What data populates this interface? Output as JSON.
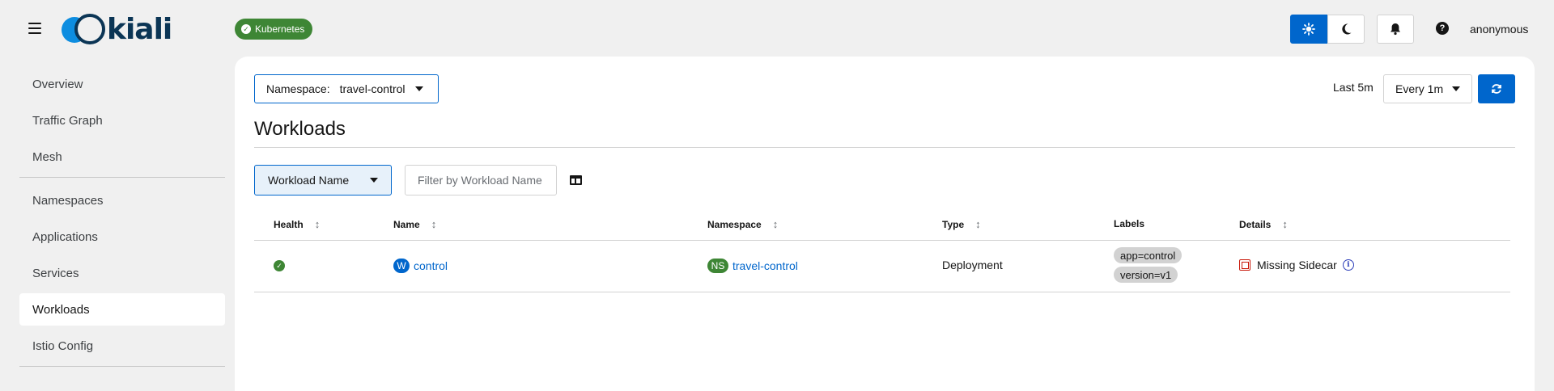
{
  "masthead": {
    "logo_text": "kiali",
    "cluster_badge": "Kubernetes",
    "user": "anonymous",
    "icons": [
      "menu-icon",
      "sun-icon",
      "moon-icon",
      "bell-icon",
      "help-icon"
    ]
  },
  "sidebar": {
    "items": [
      {
        "label": "Overview",
        "active": false
      },
      {
        "label": "Traffic Graph",
        "active": false
      },
      {
        "label": "Mesh",
        "active": false
      },
      {
        "label": "Namespaces",
        "active": false
      },
      {
        "label": "Applications",
        "active": false
      },
      {
        "label": "Services",
        "active": false
      },
      {
        "label": "Workloads",
        "active": true
      },
      {
        "label": "Istio Config",
        "active": false
      }
    ]
  },
  "toolbar": {
    "namespace_label": "Namespace:",
    "namespace_value": "travel-control",
    "time_range": "Last 5m",
    "refresh_interval": "Every 1m"
  },
  "page": {
    "title": "Workloads"
  },
  "filter": {
    "type": "Workload Name",
    "placeholder": "Filter by Workload Name"
  },
  "table": {
    "columns": [
      "Health",
      "Name",
      "Namespace",
      "Type",
      "Labels",
      "Details"
    ],
    "rows": [
      {
        "health": "healthy",
        "name_badge": "W",
        "name": "control",
        "namespace_badge": "NS",
        "namespace": "travel-control",
        "type": "Deployment",
        "labels": [
          "app=control",
          "version=v1"
        ],
        "details": "Missing Sidecar"
      }
    ]
  },
  "colors": {
    "accent": "#0066cc",
    "success": "#3e8635",
    "danger": "#c9190b"
  }
}
